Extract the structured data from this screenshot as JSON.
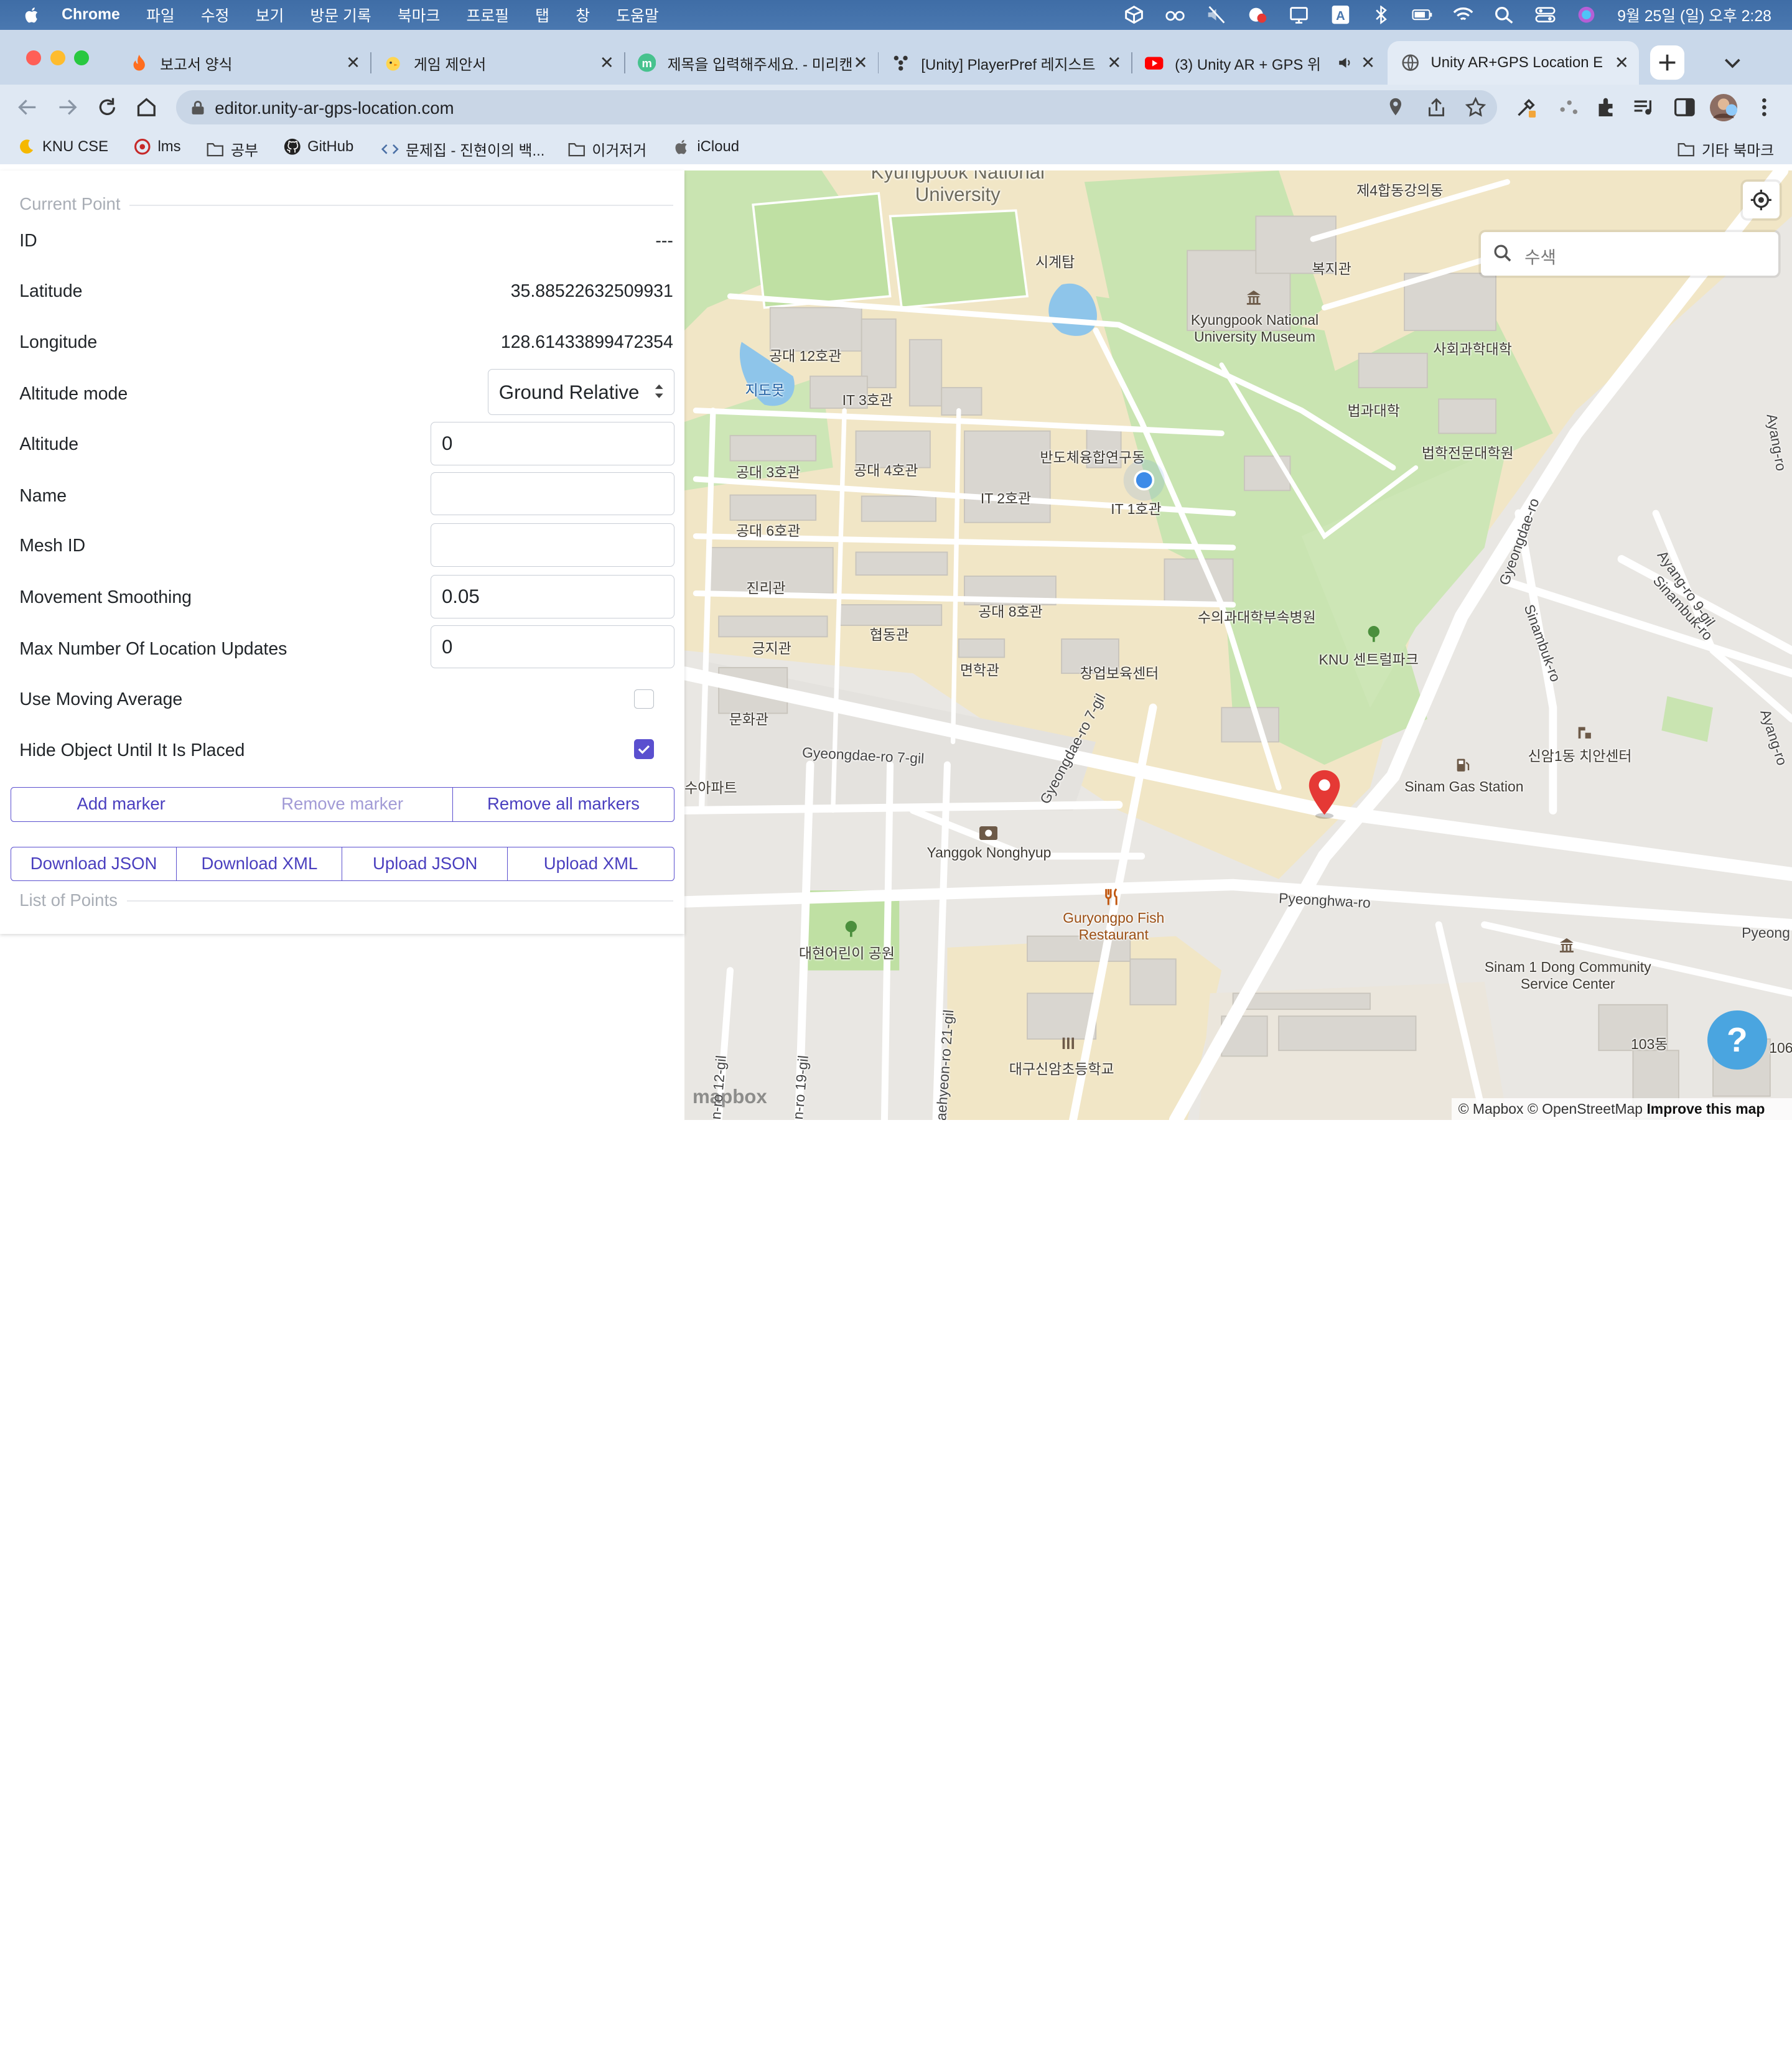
{
  "menubar": {
    "app": "Chrome",
    "items": [
      "파일",
      "수정",
      "보기",
      "방문 기록",
      "북마크",
      "프로필",
      "탭",
      "창",
      "도움말"
    ],
    "clock": "9월 25일 (일) 오후 2:28"
  },
  "tabs": [
    {
      "title": "보고서 양식"
    },
    {
      "title": "게임 제안서"
    },
    {
      "title": "제목을 입력해주세요. - 미리캔"
    },
    {
      "title": "[Unity] PlayerPref 레지스트"
    },
    {
      "title": "(3) Unity AR + GPS 위"
    },
    {
      "title": "Unity AR+GPS Location E"
    }
  ],
  "address": {
    "url": "editor.unity-ar-gps-location.com"
  },
  "bookmarks": {
    "items": [
      "KNU CSE",
      "lms",
      "공부",
      "GitHub",
      "문제집 - 진현이의 백...",
      "이거저거",
      "iCloud"
    ],
    "other": "기타 북마크"
  },
  "panel": {
    "current_point_legend": "Current Point",
    "id_label": "ID",
    "id_value": "---",
    "lat_label": "Latitude",
    "lat_value": "35.88522632509931",
    "lon_label": "Longitude",
    "lon_value": "128.61433899472354",
    "alt_mode_label": "Altitude mode",
    "alt_mode_value": "Ground Relative",
    "altitude_label": "Altitude",
    "altitude_value": "0",
    "name_label": "Name",
    "name_value": "",
    "mesh_label": "Mesh ID",
    "mesh_value": "",
    "smoothing_label": "Movement Smoothing",
    "smoothing_value": "0.05",
    "max_updates_label": "Max Number Of Location Updates",
    "max_updates_value": "0",
    "moving_avg_label": "Use Moving Average",
    "moving_avg_checked": false,
    "hide_label": "Hide Object Until It Is Placed",
    "hide_checked": true,
    "buttons": {
      "add": "Add marker",
      "remove": "Remove marker",
      "remove_all": "Remove all markers",
      "dl_json": "Download JSON",
      "dl_xml": "Download XML",
      "up_json": "Upload JSON",
      "up_xml": "Upload XML"
    },
    "list_legend": "List of Points"
  },
  "map": {
    "search_placeholder": "수색",
    "labels": {
      "university": "Kyungpook National\nUniversity",
      "bldg_4hap": "제4합동강의동",
      "sigyetap": "시계탑",
      "bokji": "복지관",
      "museum": "Kyungpook National\nUniversity Museum",
      "sahoe": "사회과학대학",
      "gongdae12": "공대 12호관",
      "jidomot": "지도못",
      "it3": "IT 3호관",
      "beopgwa": "법과대학",
      "beophak": "법학전문대학원",
      "bandoche": "반도체융합연구동",
      "gongdae3": "공대 3호관",
      "gongdae4": "공대 4호관",
      "it2": "IT 2호관",
      "it1": "IT 1호관",
      "gongdae6": "공대 6호관",
      "jinri": "진리관",
      "gongdae8": "공대 8호관",
      "vet": "수의과대학부속병원",
      "hyeopdong": "협동관",
      "geungji": "긍지관",
      "myeon": "면학관",
      "changup": "창업보육센터",
      "central": "KNU 센트럴파크",
      "munhwa": "문화관",
      "suapt": "수아파트",
      "gyeongdae7": "Gyeongdae-ro 7-gil",
      "gyeongdae7b": "Gyeongdae-ro 7-gil",
      "gyeongdae": "Gyeongdae-ro",
      "sinambuk": "Sinambuk-ro",
      "ayang9": "Ayang-ro 9-gil",
      "ayang": "Ayang-ro",
      "sinam_center": "신암1동 치안센터",
      "gas": "Sinam Gas Station",
      "yanggok": "Yanggok Nonghyup",
      "pyeonghwa": "Pyeonghwa-ro",
      "pyeongs": "Pyeong",
      "fish": "Guryongpo Fish\nRestaurant",
      "daehyeon": "대현어린이 공원",
      "sinam1": "Sinam 1 Dong Community\nService Center",
      "school": "대구신암초등학교",
      "ro12": "n-ro 12-gil",
      "ro19": "n-ro 19-gil",
      "ro21": "aehyeon-ro 21-gil",
      "n103": "103동",
      "n106": "106"
    },
    "attribution": "© Mapbox © OpenStreetMap",
    "improve": "Improve this map",
    "logo": "mapbox",
    "help": "?"
  }
}
